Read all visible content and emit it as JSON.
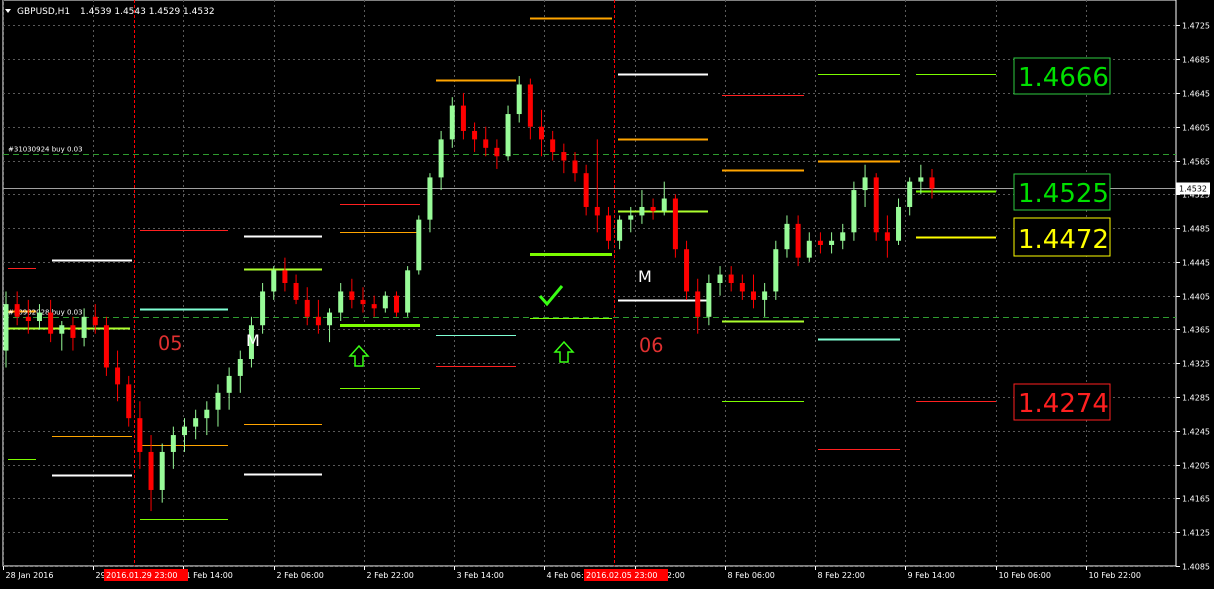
{
  "header": {
    "symbol_timeframe": "GBPUSD,H1",
    "ohlc": "1.4539 1.4543 1.4529 1.4532"
  },
  "chart_data": {
    "type": "candlestick",
    "ylim": [
      1.4085,
      1.4755
    ],
    "y_ticks": [
      "1.4725",
      "1.4685",
      "1.4645",
      "1.4605",
      "1.4565",
      "1.4525",
      "1.4485",
      "1.4445",
      "1.4405",
      "1.4365",
      "1.4325",
      "1.4285",
      "1.4245",
      "1.4205",
      "1.4165",
      "1.4125",
      "1.4085"
    ],
    "x_ticks": [
      "28 Jan 2016",
      "29 Jan",
      "1 Feb 14:00",
      "2 Feb 06:00",
      "2 Feb 22:00",
      "3 Feb 14:00",
      "4 Feb 06:00",
      "4 Feb 22:00",
      "8 Feb 06:00",
      "8 Feb 22:00",
      "9 Feb 14:00",
      "10 Feb 06:00",
      "10 Feb 22:00"
    ],
    "x_separator_labels": [
      "2016.01.29 23:00",
      "2016.02.05 23:00"
    ],
    "current_price": "1.4532",
    "series": [
      {
        "ohlc_path": [
          [
            1.434,
            1.441,
            1.432,
            1.4395
          ],
          [
            1.4395,
            1.441,
            1.437,
            1.438
          ],
          [
            1.438,
            1.44,
            1.436,
            1.4375
          ],
          [
            1.4375,
            1.4395,
            1.4365,
            1.4385
          ],
          [
            1.4385,
            1.44,
            1.435,
            1.436
          ],
          [
            1.436,
            1.4375,
            1.434,
            1.437
          ],
          [
            1.437,
            1.438,
            1.434,
            1.4355
          ],
          [
            1.4355,
            1.439,
            1.4345,
            1.438
          ],
          [
            1.438,
            1.4395,
            1.436,
            1.437
          ],
          [
            1.437,
            1.438,
            1.431,
            1.432
          ],
          [
            1.432,
            1.434,
            1.428,
            1.43
          ],
          [
            1.43,
            1.431,
            1.425,
            1.426
          ],
          [
            1.426,
            1.428,
            1.42,
            1.422
          ],
          [
            1.422,
            1.424,
            1.415,
            1.4175
          ],
          [
            1.4175,
            1.423,
            1.416,
            1.422
          ],
          [
            1.422,
            1.425,
            1.42,
            1.424
          ],
          [
            1.424,
            1.426,
            1.422,
            1.425
          ],
          [
            1.425,
            1.427,
            1.4235,
            1.426
          ],
          [
            1.426,
            1.428,
            1.424,
            1.427
          ],
          [
            1.427,
            1.43,
            1.425,
            1.429
          ],
          [
            1.429,
            1.432,
            1.427,
            1.431
          ],
          [
            1.431,
            1.434,
            1.429,
            1.433
          ],
          [
            1.433,
            1.438,
            1.432,
            1.437
          ],
          [
            1.437,
            1.442,
            1.436,
            1.441
          ],
          [
            1.441,
            1.444,
            1.44,
            1.4435
          ],
          [
            1.4435,
            1.445,
            1.441,
            1.442
          ],
          [
            1.442,
            1.443,
            1.4395,
            1.44
          ],
          [
            1.44,
            1.4415,
            1.437,
            1.438
          ],
          [
            1.438,
            1.44,
            1.436,
            1.437
          ],
          [
            1.437,
            1.439,
            1.435,
            1.4385
          ],
          [
            1.4385,
            1.442,
            1.4375,
            1.441
          ],
          [
            1.441,
            1.4425,
            1.439,
            1.44
          ],
          [
            1.44,
            1.4415,
            1.4385,
            1.4395
          ],
          [
            1.4395,
            1.4405,
            1.438,
            1.439
          ],
          [
            1.439,
            1.441,
            1.4385,
            1.4405
          ],
          [
            1.4405,
            1.441,
            1.438,
            1.4385
          ],
          [
            1.4385,
            1.444,
            1.438,
            1.4435
          ],
          [
            1.4435,
            1.45,
            1.443,
            1.4495
          ],
          [
            1.4495,
            1.455,
            1.448,
            1.4545
          ],
          [
            1.4545,
            1.46,
            1.453,
            1.459
          ],
          [
            1.459,
            1.464,
            1.458,
            1.463
          ],
          [
            1.463,
            1.4645,
            1.459,
            1.46
          ],
          [
            1.46,
            1.461,
            1.4575,
            1.459
          ],
          [
            1.459,
            1.4605,
            1.457,
            1.458
          ],
          [
            1.458,
            1.459,
            1.4555,
            1.457
          ],
          [
            1.457,
            1.463,
            1.4565,
            1.462
          ],
          [
            1.462,
            1.4665,
            1.461,
            1.4655
          ],
          [
            1.4655,
            1.4662,
            1.459,
            1.4605
          ],
          [
            1.4605,
            1.4625,
            1.457,
            1.459
          ],
          [
            1.459,
            1.46,
            1.4565,
            1.4575
          ],
          [
            1.4575,
            1.4585,
            1.455,
            1.4565
          ],
          [
            1.4565,
            1.4575,
            1.454,
            1.455
          ],
          [
            1.455,
            1.456,
            1.45,
            1.451
          ],
          [
            1.451,
            1.459,
            1.448,
            1.45
          ],
          [
            1.45,
            1.451,
            1.446,
            1.447
          ],
          [
            1.447,
            1.45,
            1.446,
            1.4495
          ],
          [
            1.4495,
            1.451,
            1.448,
            1.45
          ],
          [
            1.45,
            1.453,
            1.449,
            1.451
          ],
          [
            1.451,
            1.452,
            1.4495,
            1.4505
          ],
          [
            1.4505,
            1.454,
            1.45,
            1.452
          ],
          [
            1.452,
            1.4525,
            1.445,
            1.446
          ],
          [
            1.446,
            1.447,
            1.44,
            1.441
          ],
          [
            1.441,
            1.4425,
            1.436,
            1.438
          ],
          [
            1.438,
            1.443,
            1.437,
            1.442
          ],
          [
            1.442,
            1.444,
            1.4405,
            1.443
          ],
          [
            1.443,
            1.444,
            1.441,
            1.442
          ],
          [
            1.442,
            1.443,
            1.44,
            1.441
          ],
          [
            1.441,
            1.443,
            1.439,
            1.44
          ],
          [
            1.44,
            1.442,
            1.438,
            1.441
          ],
          [
            1.441,
            1.447,
            1.44,
            1.446
          ],
          [
            1.446,
            1.45,
            1.445,
            1.449
          ],
          [
            1.449,
            1.45,
            1.444,
            1.445
          ],
          [
            1.445,
            1.448,
            1.4445,
            1.447
          ],
          [
            1.447,
            1.448,
            1.4455,
            1.4465
          ],
          [
            1.4465,
            1.448,
            1.4455,
            1.447
          ],
          [
            1.447,
            1.449,
            1.446,
            1.448
          ],
          [
            1.448,
            1.454,
            1.447,
            1.453
          ],
          [
            1.453,
            1.456,
            1.451,
            1.4545
          ],
          [
            1.4545,
            1.455,
            1.447,
            1.448
          ],
          [
            1.448,
            1.45,
            1.445,
            1.447
          ],
          [
            1.447,
            1.452,
            1.4465,
            1.451
          ],
          [
            1.451,
            1.4545,
            1.45,
            1.454
          ],
          [
            1.454,
            1.456,
            1.4525,
            1.4545
          ],
          [
            1.4545,
            1.4555,
            1.452,
            1.4532
          ]
        ]
      }
    ],
    "levels_right": [
      {
        "value": "1.4666",
        "color": "#00e000",
        "box_border": "#2ecc40"
      },
      {
        "value": "1.4525",
        "color": "#00e000",
        "box_border": "#2ecc40"
      },
      {
        "value": "1.4472",
        "color": "#ffff00",
        "box_border": "#ffff00"
      },
      {
        "value": "1.4274",
        "color": "#ff2020",
        "box_border": "#ff2020"
      }
    ],
    "order_labels": [
      {
        "text": "#31030924 buy 0.03",
        "price": 1.4573
      },
      {
        "text": "#30902028 buy 0.03",
        "price": 1.438
      }
    ],
    "annotations": [
      {
        "text": "05",
        "color": "#e03030"
      },
      {
        "text": "M",
        "color": "#ffffff"
      },
      {
        "text": "M",
        "color": "#ffffff"
      },
      {
        "text": "06",
        "color": "#e03030"
      }
    ],
    "colors": {
      "background": "#000000",
      "bull": "#98fb98",
      "bear": "#ff0000",
      "grid": "#5a5a5a",
      "separator": "#ff0000",
      "axis_text": "#ffffff"
    }
  }
}
